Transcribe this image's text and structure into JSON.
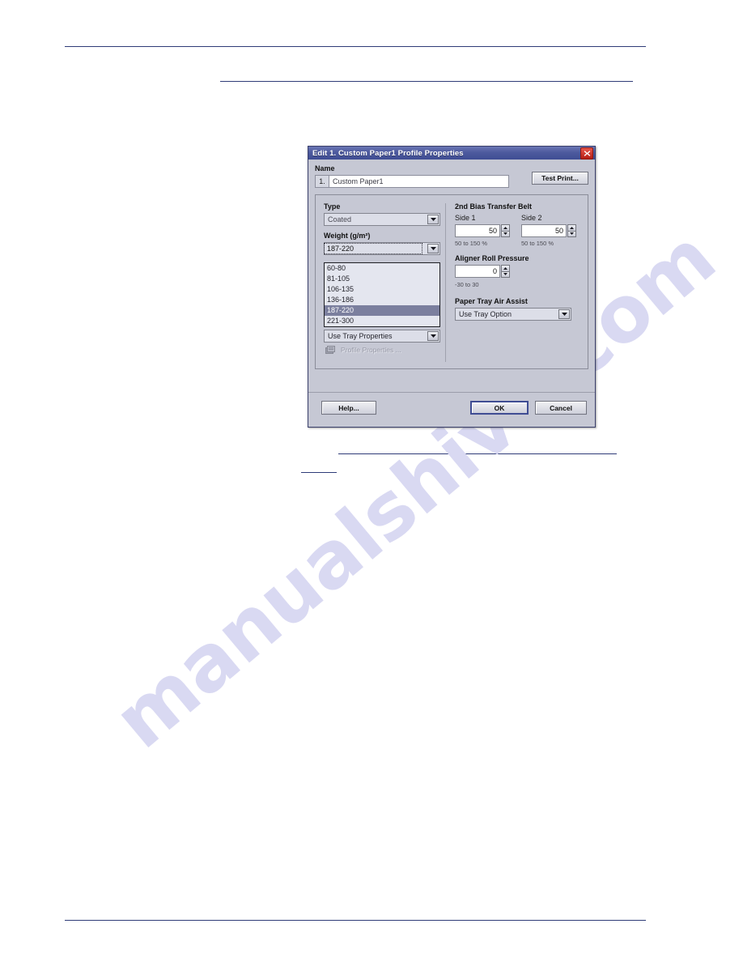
{
  "page": {
    "watermark_text": "manualshive.com",
    "rule_color": "#2f3c78"
  },
  "dialog": {
    "title": "Edit 1. Custom Paper1 Profile Properties",
    "close_icon": "close-icon",
    "name": {
      "label": "Name",
      "index": "1.",
      "value": "Custom Paper1",
      "placeholder": "Custom Paper1"
    },
    "test_print_label": "Test Print...",
    "left_column": {
      "type": {
        "label": "Type",
        "value": "Coated"
      },
      "weight": {
        "label": "Weight (g/m²)",
        "value": "187-220",
        "options": [
          "60-80",
          "81-105",
          "106-135",
          "136-186",
          "187-220",
          "221-300"
        ],
        "selected_index": 4
      },
      "tray": {
        "value": "Use Tray Properties"
      },
      "profile_properties": {
        "label": "Profile Properties ...",
        "icon": "profile-properties-icon",
        "enabled": false
      }
    },
    "right_column": {
      "bias_transfer_belt": {
        "title": "2nd Bias Transfer Belt",
        "side1": {
          "label": "Side 1",
          "value": "50",
          "hint": "50 to 150 %"
        },
        "side2": {
          "label": "Side 2",
          "value": "50",
          "hint": "50 to 150 %"
        }
      },
      "aligner_roll_pressure": {
        "title": "Aligner Roll Pressure",
        "value": "0",
        "hint": "-30 to 30"
      },
      "paper_tray_air_assist": {
        "title": "Paper Tray Air Assist",
        "value": "Use Tray Option"
      }
    },
    "buttons": {
      "help": "Help...",
      "ok": "OK",
      "cancel": "Cancel"
    }
  }
}
